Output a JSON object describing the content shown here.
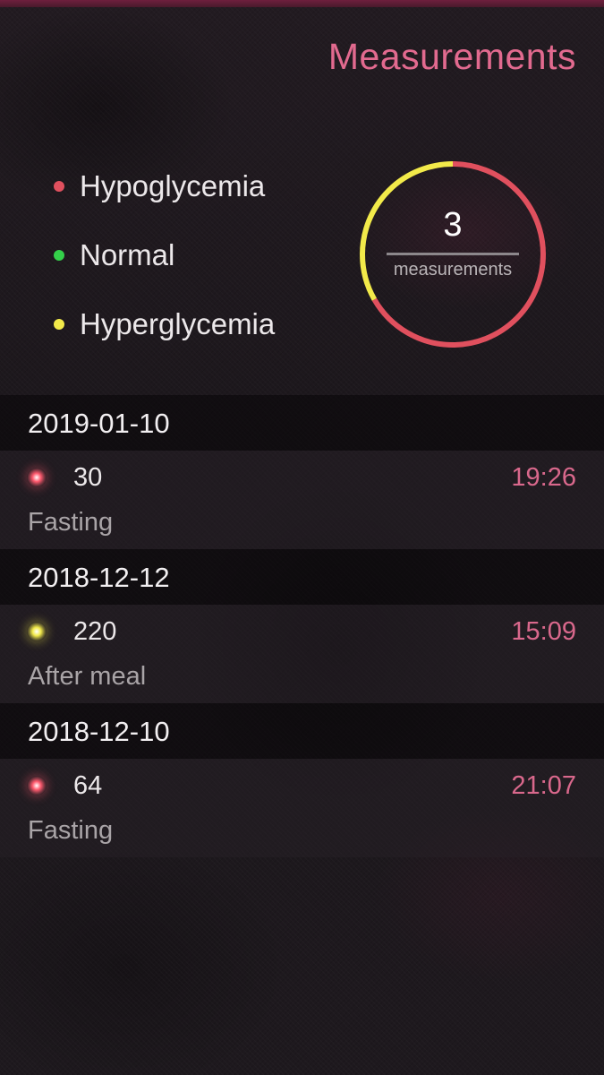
{
  "header": {
    "title": "Measurements"
  },
  "legend": [
    {
      "label": "Hypoglycemia",
      "color": "#e0505e"
    },
    {
      "label": "Normal",
      "color": "#34d04a"
    },
    {
      "label": "Hyperglycemia",
      "color": "#f2ea4a"
    }
  ],
  "summary": {
    "count": "3",
    "caption": "measurements",
    "ring_segments": [
      {
        "status": "hyperglycemia",
        "fraction": 0.3333,
        "color": "#f2ea4a"
      },
      {
        "status": "hypoglycemia",
        "fraction": 0.6667,
        "color": "#e0505e"
      }
    ]
  },
  "groups": [
    {
      "date": "2019-01-10",
      "entries": [
        {
          "value": "30",
          "time": "19:26",
          "meal": "Fasting",
          "status": "hypoglycemia",
          "color": "#ff5a6e"
        }
      ]
    },
    {
      "date": "2018-12-12",
      "entries": [
        {
          "value": "220",
          "time": "15:09",
          "meal": "After meal",
          "status": "hyperglycemia",
          "color": "#f2ea4a"
        }
      ]
    },
    {
      "date": "2018-12-10",
      "entries": [
        {
          "value": "64",
          "time": "21:07",
          "meal": "Fasting",
          "status": "hypoglycemia",
          "color": "#ff5a6e"
        }
      ]
    }
  ]
}
